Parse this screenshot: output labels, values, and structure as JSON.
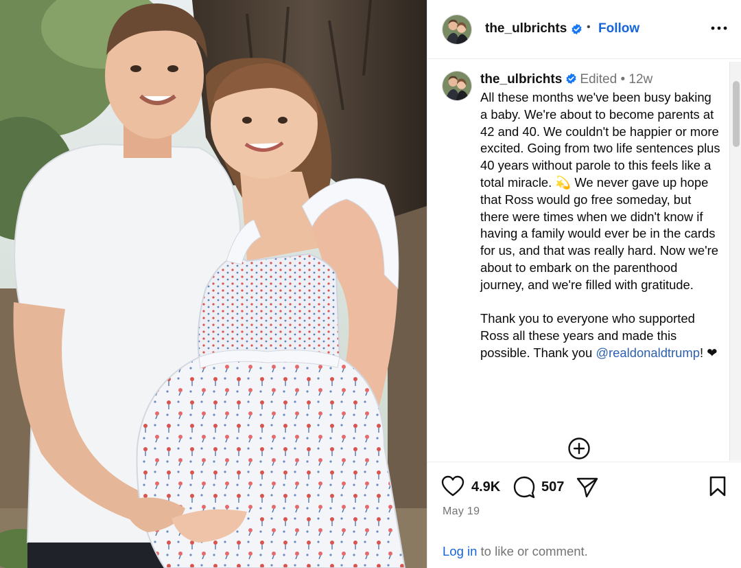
{
  "post": {
    "username": "the_ulbrichts",
    "follow_label": "Follow",
    "header_separator": "•",
    "caption": {
      "username": "the_ulbrichts",
      "edited": "Edited",
      "separator": "•",
      "age": "12w",
      "paragraph1": "All these months we've been busy baking a baby. We're about to become parents at 42 and 40. We couldn't be happier or more excited. Going from two life sentences plus 40 years without parole to this feels like a total miracle. 💫 We never gave up hope that Ross would go free someday, but there were times when we didn't know if having a family would ever be in the cards for us, and that was really hard. Now we're about to embark on the parenthood journey, and we're filled with gratitude.",
      "paragraph2": "Thank you to everyone who supported Ross all these years and made this possible. Thank you",
      "mention": "@realdonaldtrump",
      "ending": "! ❤"
    },
    "likes": "4.9K",
    "comments": "507",
    "date": "May 19",
    "login_link": "Log in",
    "login_text": " to like or comment."
  },
  "icons": {
    "verified": "verified-badge-icon",
    "more": "more-options-icon",
    "add_comment": "plus-circle-icon",
    "like": "heart-icon",
    "comment": "speech-bubble-icon",
    "share": "paper-plane-icon",
    "save": "bookmark-icon"
  },
  "colors": {
    "link_blue": "#1565d8",
    "verified_blue": "#1877f2",
    "muted_gray": "#737373"
  }
}
